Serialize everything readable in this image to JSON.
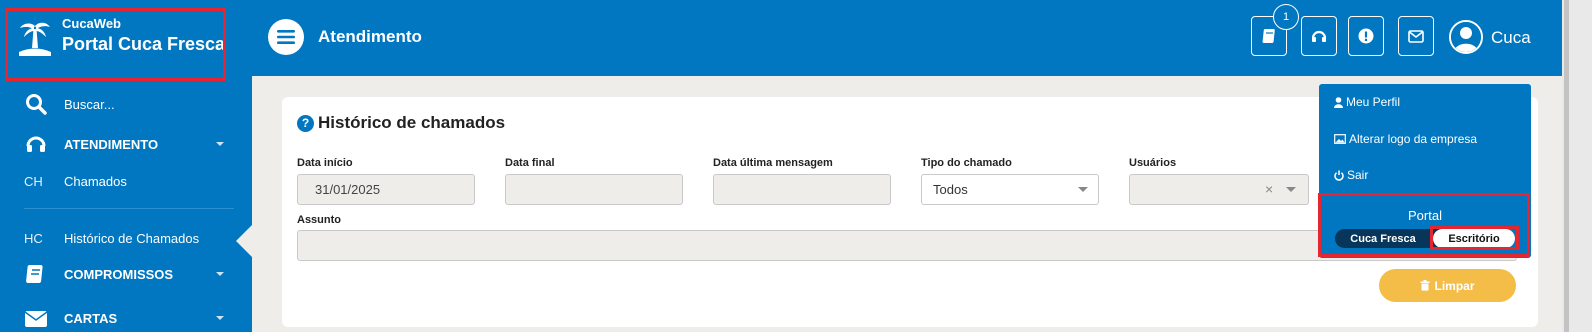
{
  "brand": {
    "subtitle": "CucaWeb",
    "title": "Portal Cuca Fresca"
  },
  "sidebar": {
    "search_label": "Buscar...",
    "items": [
      {
        "label": "ATENDIMENTO",
        "icon": "headset-icon"
      },
      {
        "abbr": "CH",
        "label": "Chamados"
      },
      {
        "abbr": "HC",
        "label": "Histórico de Chamados"
      },
      {
        "label": "COMPROMISSOS",
        "icon": "book-icon"
      },
      {
        "label": "CARTAS",
        "icon": "envelope-icon"
      }
    ]
  },
  "header": {
    "title": "Atendimento",
    "badge_count": "1",
    "user_name": "Cuca",
    "icons": [
      "book-icon",
      "headset-icon",
      "alert-icon",
      "envelope-icon"
    ]
  },
  "card": {
    "title": "Histórico de chamados",
    "fields": {
      "data_inicio": {
        "label": "Data início",
        "value": "31/01/2025"
      },
      "data_final": {
        "label": "Data final",
        "value": ""
      },
      "data_ultima": {
        "label": "Data última mensagem",
        "value": ""
      },
      "tipo": {
        "label": "Tipo do chamado",
        "value": "Todos"
      },
      "usuarios": {
        "label": "Usuários",
        "value": ""
      },
      "assunto": {
        "label": "Assunto",
        "value": ""
      }
    },
    "clear_button": "Limpar"
  },
  "dropdown": {
    "items": [
      {
        "label": "Meu Perfil",
        "icon": "user-icon"
      },
      {
        "label": "Alterar logo da empresa",
        "icon": "image-icon"
      },
      {
        "label": "Sair",
        "icon": "power-icon"
      }
    ],
    "portal_title": "Portal",
    "portal_options": [
      "Cuca Fresca",
      "Escritório"
    ],
    "portal_selected": "Escritório"
  },
  "colors": {
    "primary": "#0077c0",
    "highlight": "#e3262f",
    "warning": "#f4bd48",
    "toggle_dark": "#08365a"
  }
}
